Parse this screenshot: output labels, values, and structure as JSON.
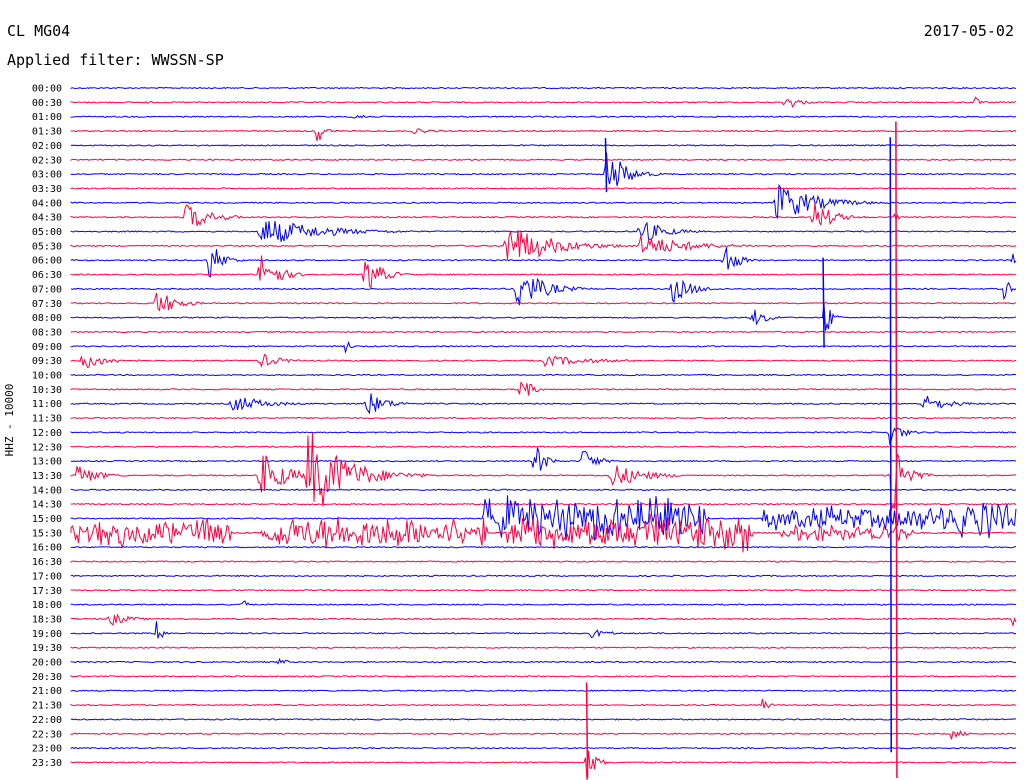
{
  "header": {
    "station": "CL MG04",
    "date": "2017-05-02",
    "filter": "Applied filter: WWSSN-SP"
  },
  "chart_data": {
    "type": "line",
    "title": "CL MG04",
    "subtitle": "Applied filter: WWSSN-SP",
    "date": "2017-05-02",
    "ylabel": "HHZ - 10000",
    "xlabel": "",
    "colors": [
      "#0000ff",
      "#ff0040"
    ],
    "grid": false,
    "legend": "none",
    "rows": [
      "00:00",
      "00:30",
      "01:00",
      "01:30",
      "02:00",
      "02:30",
      "03:00",
      "03:30",
      "04:00",
      "04:30",
      "05:00",
      "05:30",
      "06:00",
      "06:30",
      "07:00",
      "07:30",
      "08:00",
      "08:30",
      "09:00",
      "09:30",
      "10:00",
      "10:30",
      "11:00",
      "11:30",
      "12:00",
      "12:30",
      "13:00",
      "13:30",
      "14:00",
      "14:30",
      "15:00",
      "15:30",
      "16:00",
      "16:30",
      "17:00",
      "17:30",
      "18:00",
      "18:30",
      "19:00",
      "19:30",
      "20:00",
      "20:30",
      "21:00",
      "21:30",
      "22:00",
      "22:30",
      "23:00",
      "23:30"
    ],
    "events": [
      {
        "row": "00:30",
        "pos": 0.08,
        "amp": 4,
        "dur": 0.006
      },
      {
        "row": "00:30",
        "pos": 0.755,
        "amp": 9,
        "dur": 0.02
      },
      {
        "row": "00:30",
        "pos": 0.955,
        "amp": 7,
        "dur": 0.008
      },
      {
        "row": "01:00",
        "pos": 0.3,
        "amp": 10,
        "dur": 0.012
      },
      {
        "row": "01:30",
        "pos": 0.26,
        "amp": 14,
        "dur": 0.012
      },
      {
        "row": "01:30",
        "pos": 0.36,
        "amp": 3,
        "dur": 0.04
      },
      {
        "row": "03:00",
        "pos": 0.565,
        "amp": 30,
        "dur": 0.03
      },
      {
        "row": "04:00",
        "pos": 0.745,
        "amp": 22,
        "dur": 0.06
      },
      {
        "row": "04:30",
        "pos": 0.12,
        "amp": 16,
        "dur": 0.04
      },
      {
        "row": "04:30",
        "pos": 0.785,
        "amp": 18,
        "dur": 0.03
      },
      {
        "row": "04:30",
        "pos": 0.87,
        "amp": 4,
        "dur": 0.01
      },
      {
        "row": "05:00",
        "pos": 0.2,
        "amp": 16,
        "dur": 0.09
      },
      {
        "row": "05:00",
        "pos": 0.6,
        "amp": 14,
        "dur": 0.04
      },
      {
        "row": "05:30",
        "pos": 0.46,
        "amp": 24,
        "dur": 0.07
      },
      {
        "row": "05:30",
        "pos": 0.6,
        "amp": 12,
        "dur": 0.08
      },
      {
        "row": "06:00",
        "pos": 0.145,
        "amp": 24,
        "dur": 0.02
      },
      {
        "row": "06:00",
        "pos": 0.69,
        "amp": 20,
        "dur": 0.02
      },
      {
        "row": "06:00",
        "pos": 0.995,
        "amp": 8,
        "dur": 0.006
      },
      {
        "row": "06:30",
        "pos": 0.2,
        "amp": 28,
        "dur": 0.025
      },
      {
        "row": "06:30",
        "pos": 0.31,
        "amp": 24,
        "dur": 0.025
      },
      {
        "row": "07:00",
        "pos": 0.47,
        "amp": 26,
        "dur": 0.04
      },
      {
        "row": "07:00",
        "pos": 0.635,
        "amp": 16,
        "dur": 0.03
      },
      {
        "row": "07:00",
        "pos": 0.985,
        "amp": 12,
        "dur": 0.015
      },
      {
        "row": "07:30",
        "pos": 0.09,
        "amp": 16,
        "dur": 0.03
      },
      {
        "row": "08:00",
        "pos": 0.72,
        "amp": 10,
        "dur": 0.025
      },
      {
        "row": "08:00",
        "pos": 0.795,
        "amp": 34,
        "dur": 0.01
      },
      {
        "row": "09:00",
        "pos": 0.29,
        "amp": 12,
        "dur": 0.006
      },
      {
        "row": "09:30",
        "pos": 0.01,
        "amp": 10,
        "dur": 0.04
      },
      {
        "row": "09:30",
        "pos": 0.2,
        "amp": 8,
        "dur": 0.03
      },
      {
        "row": "09:30",
        "pos": 0.5,
        "amp": 6,
        "dur": 0.08
      },
      {
        "row": "10:30",
        "pos": 0.475,
        "amp": 18,
        "dur": 0.015
      },
      {
        "row": "11:00",
        "pos": 0.17,
        "amp": 10,
        "dur": 0.05
      },
      {
        "row": "11:00",
        "pos": 0.31,
        "amp": 16,
        "dur": 0.03
      },
      {
        "row": "11:00",
        "pos": 0.9,
        "amp": 10,
        "dur": 0.04
      },
      {
        "row": "12:00",
        "pos": 0.865,
        "amp": 14,
        "dur": 0.02
      },
      {
        "row": "13:00",
        "pos": 0.49,
        "amp": 22,
        "dur": 0.015
      },
      {
        "row": "13:00",
        "pos": 0.54,
        "amp": 16,
        "dur": 0.02
      },
      {
        "row": "13:30",
        "pos": 0.005,
        "amp": 14,
        "dur": 0.03
      },
      {
        "row": "13:30",
        "pos": 0.2,
        "amp": 26,
        "dur": 0.04
      },
      {
        "row": "13:30",
        "pos": 0.25,
        "amp": 50,
        "dur": 0.06
      },
      {
        "row": "13:30",
        "pos": 0.57,
        "amp": 14,
        "dur": 0.05
      },
      {
        "row": "13:30",
        "pos": 0.865,
        "amp": 60,
        "dur": 0.02
      },
      {
        "row": "15:30",
        "pos": 0.0,
        "amp": 16,
        "dur": 0.17,
        "noise": true
      },
      {
        "row": "15:30",
        "pos": 0.2,
        "amp": 20,
        "dur": 0.24,
        "noise": true
      },
      {
        "row": "15:30",
        "pos": 0.46,
        "amp": 22,
        "dur": 0.26,
        "noise": true
      },
      {
        "row": "15:30",
        "pos": 0.75,
        "amp": 10,
        "dur": 0.14,
        "noise": true
      },
      {
        "row": "15:00",
        "pos": 0.435,
        "amp": 24,
        "dur": 0.24,
        "noise": true
      },
      {
        "row": "15:00",
        "pos": 0.73,
        "amp": 14,
        "dur": 0.25,
        "noise": true
      },
      {
        "row": "15:00",
        "pos": 0.935,
        "amp": 24,
        "dur": 0.065,
        "noise": true
      },
      {
        "row": "18:00",
        "pos": 0.18,
        "amp": 12,
        "dur": 0.006
      },
      {
        "row": "18:30",
        "pos": 0.04,
        "amp": 8,
        "dur": 0.03
      },
      {
        "row": "18:30",
        "pos": 0.995,
        "amp": 10,
        "dur": 0.006
      },
      {
        "row": "19:00",
        "pos": 0.09,
        "amp": 14,
        "dur": 0.01
      },
      {
        "row": "19:00",
        "pos": 0.55,
        "amp": 5,
        "dur": 0.03
      },
      {
        "row": "20:00",
        "pos": 0.22,
        "amp": 6,
        "dur": 0.01
      },
      {
        "row": "21:30",
        "pos": 0.73,
        "amp": 10,
        "dur": 0.01
      },
      {
        "row": "22:30",
        "pos": 0.93,
        "amp": 6,
        "dur": 0.02
      },
      {
        "row": "23:30",
        "pos": 0.545,
        "amp": 20,
        "dur": 0.015
      }
    ],
    "spikes": [
      {
        "row": "16:30",
        "pos": 0.872,
        "amp": 440,
        "color": "#ff0040"
      },
      {
        "row": "16:00",
        "pos": 0.866,
        "amp": 410,
        "color": "#0000ff"
      },
      {
        "row": "23:30",
        "pos": 0.545,
        "amp": 80,
        "color": "#ff0040"
      },
      {
        "row": "03:00",
        "pos": 0.565,
        "amp": 36,
        "color": "#0000ff"
      },
      {
        "row": "08:00",
        "pos": 0.795,
        "amp": 60,
        "color": "#0000ff"
      }
    ]
  }
}
